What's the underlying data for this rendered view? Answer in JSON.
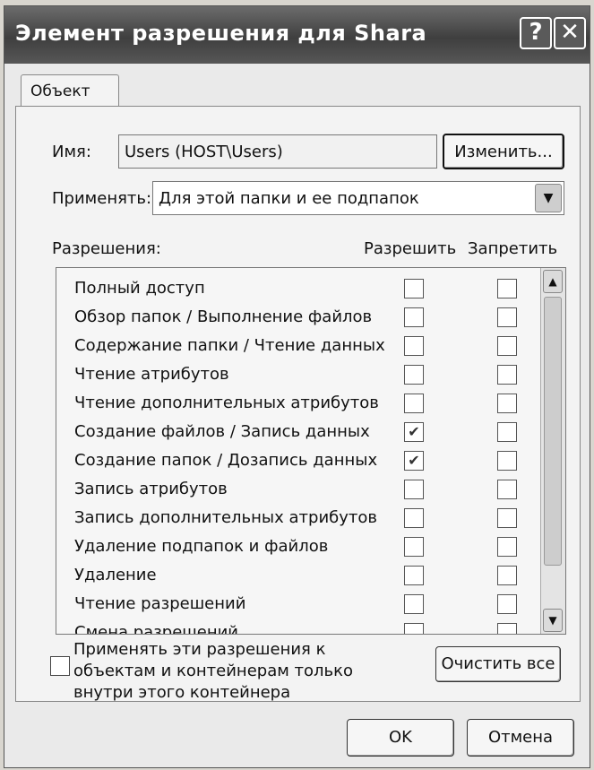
{
  "window": {
    "title": "Элемент разрешения для Shara",
    "help_symbol": "?",
    "close_symbol": "✕"
  },
  "tab": {
    "label": "Объект"
  },
  "name": {
    "label": "Имя:",
    "value": "Users (HOST\\Users)",
    "change_button": "Изменить..."
  },
  "apply_to": {
    "label": "Применять:",
    "value": "Для этой папки и ее подпапок"
  },
  "permissions": {
    "header": "Разрешения:",
    "allow_header": "Разрешить",
    "deny_header": "Запретить",
    "rows": [
      {
        "label": "Полный доступ",
        "allow": false,
        "deny": false
      },
      {
        "label": "Обзор папок / Выполнение файлов",
        "allow": false,
        "deny": false
      },
      {
        "label": "Содержание папки / Чтение данных",
        "allow": false,
        "deny": false
      },
      {
        "label": "Чтение атрибутов",
        "allow": false,
        "deny": false
      },
      {
        "label": "Чтение дополнительных атрибутов",
        "allow": false,
        "deny": false
      },
      {
        "label": "Создание файлов / Запись данных",
        "allow": true,
        "deny": false
      },
      {
        "label": "Создание папок / Дозапись данных",
        "allow": true,
        "deny": false
      },
      {
        "label": "Запись атрибутов",
        "allow": false,
        "deny": false
      },
      {
        "label": "Запись дополнительных атрибутов",
        "allow": false,
        "deny": false
      },
      {
        "label": "Удаление подпапок и файлов",
        "allow": false,
        "deny": false
      },
      {
        "label": "Удаление",
        "allow": false,
        "deny": false
      },
      {
        "label": "Чтение разрешений",
        "allow": false,
        "deny": false
      },
      {
        "label": "Смена разрешений",
        "allow": false,
        "deny": false
      }
    ]
  },
  "apply_inside": {
    "label": "Применять эти разрешения к объектам и контейнерам только внутри этого контейнера",
    "checked": false
  },
  "clear_button": "Очистить все",
  "footer": {
    "ok": "OK",
    "cancel": "Отмена"
  }
}
